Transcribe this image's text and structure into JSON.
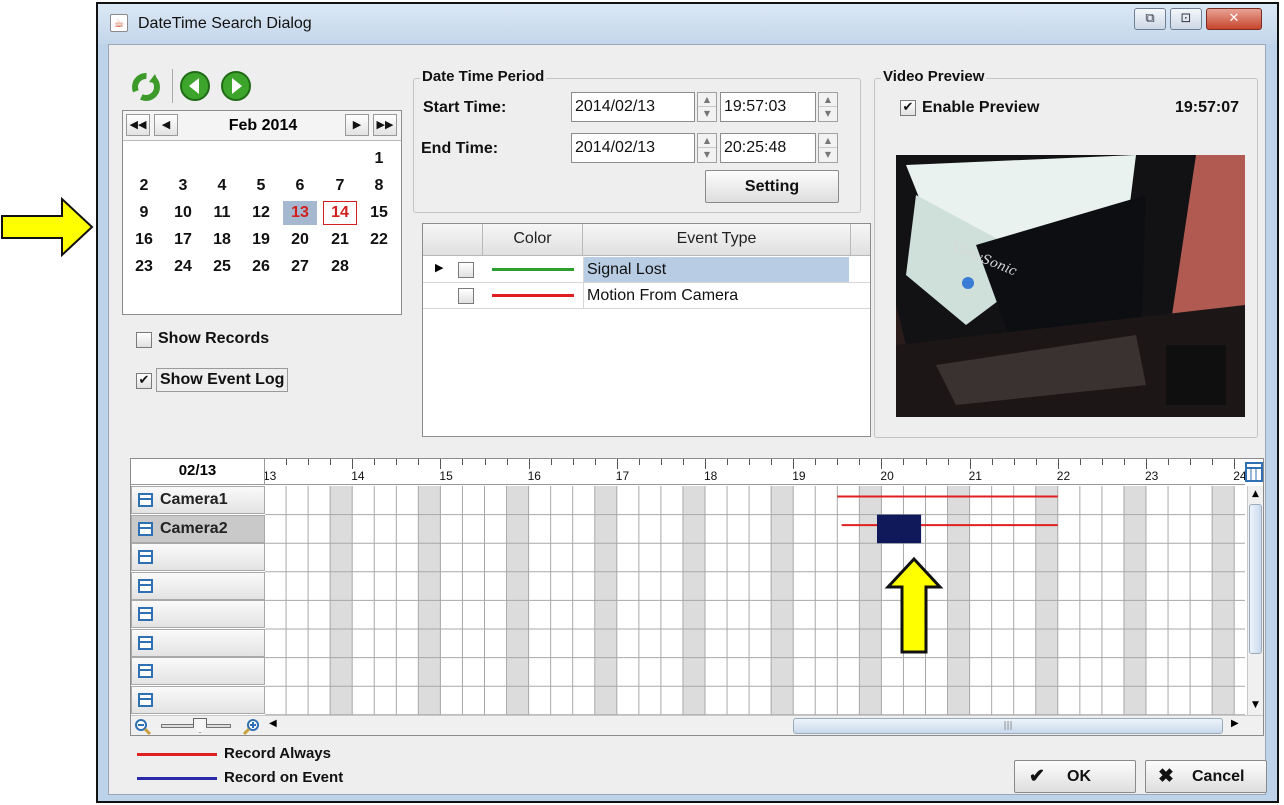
{
  "window": {
    "title": "DateTime Search Dialog",
    "controls": {
      "restore": "⧉",
      "minimize": "⊡",
      "close": "✕"
    }
  },
  "toolbar": {
    "refresh_icon": "refresh-icon",
    "prev_icon": "prev-icon",
    "next_icon": "next-icon"
  },
  "calendar": {
    "month_label": "Feb 2014",
    "nav": {
      "prev_year": "◀◀",
      "prev_month": "◀",
      "next_month": "▶",
      "next_year": "▶▶"
    },
    "selected_day": "13",
    "today": "14",
    "weeks": [
      [
        "",
        "",
        "",
        "",
        "",
        "",
        "1"
      ],
      [
        "2",
        "3",
        "4",
        "5",
        "6",
        "7",
        "8"
      ],
      [
        "9",
        "10",
        "11",
        "12",
        "13",
        "14",
        "15"
      ],
      [
        "16",
        "17",
        "18",
        "19",
        "20",
        "21",
        "22"
      ],
      [
        "23",
        "24",
        "25",
        "26",
        "27",
        "28",
        ""
      ]
    ]
  },
  "options": {
    "show_records": {
      "label": "Show Records",
      "checked": false
    },
    "show_event_log": {
      "label": "Show Event Log",
      "checked": true
    }
  },
  "period": {
    "title": "Date Time Period",
    "start_label": "Start Time:",
    "start_date": "2014/02/13",
    "start_time": "19:57:03",
    "end_label": "End Time:",
    "end_date": "2014/02/13",
    "end_time": "20:25:48",
    "setting_button": "Setting"
  },
  "events": {
    "columns": [
      "",
      "Color",
      "Event Type"
    ],
    "rows": [
      {
        "type": "Signal Lost",
        "color": "#2e9e2e",
        "checked": false,
        "selected": true
      },
      {
        "type": "Motion From Camera",
        "color": "#e02020",
        "checked": false,
        "selected": false
      }
    ]
  },
  "preview": {
    "title": "Video Preview",
    "enable_label": "Enable Preview",
    "enabled": true,
    "time": "19:57:07",
    "image_brand_text": "ViewSonic"
  },
  "timeline": {
    "date": "02/13",
    "hours": [
      "13",
      "14",
      "15",
      "16",
      "17",
      "18",
      "19",
      "20",
      "21",
      "22",
      "23",
      "24"
    ],
    "cameras": [
      "Camera1",
      "Camera2",
      "",
      "",
      "",
      "",
      "",
      ""
    ],
    "active_camera": "Camera2",
    "record_always_color": "#e02020",
    "record_on_event_color": "#101a5a",
    "tracks": [
      {
        "camera": "Camera1",
        "kind": "always",
        "start_hour": 19.5,
        "end_hour": 22.0
      },
      {
        "camera": "Camera2",
        "kind": "always",
        "start_hour": 19.55,
        "end_hour": 22.0
      },
      {
        "camera": "Camera2",
        "kind": "event",
        "start_hour": 19.95,
        "end_hour": 20.45
      }
    ]
  },
  "legend": {
    "record_always": {
      "label": "Record Always",
      "color": "#e02020"
    },
    "record_on_event": {
      "label": "Record on Event",
      "color": "#2a2aa8"
    }
  },
  "buttons": {
    "ok": "OK",
    "ok_icon": "✔",
    "cancel": "Cancel",
    "cancel_icon": "✖"
  },
  "annotation_color": "#ffff00"
}
